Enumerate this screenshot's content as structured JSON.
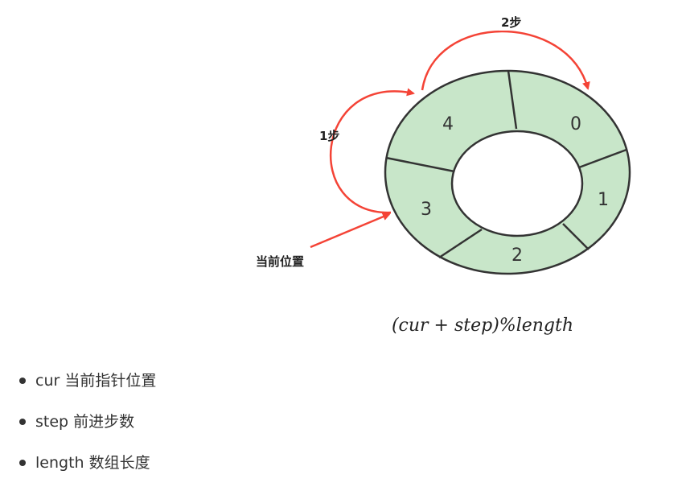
{
  "ring": {
    "segments": [
      "0",
      "1",
      "2",
      "3",
      "4"
    ],
    "fill_color": "#c8e6c9",
    "stroke_color": "#333333"
  },
  "annotations": {
    "one_step": "1步",
    "two_steps": "2步",
    "current_position": "当前位置",
    "arrow_color": "#f44336"
  },
  "formula": "(cur + step)%length",
  "bullets": [
    {
      "term": "cur",
      "desc": "当前指针位置"
    },
    {
      "term": "step",
      "desc": "前进步数"
    },
    {
      "term": "length",
      "desc": "数组长度"
    }
  ]
}
